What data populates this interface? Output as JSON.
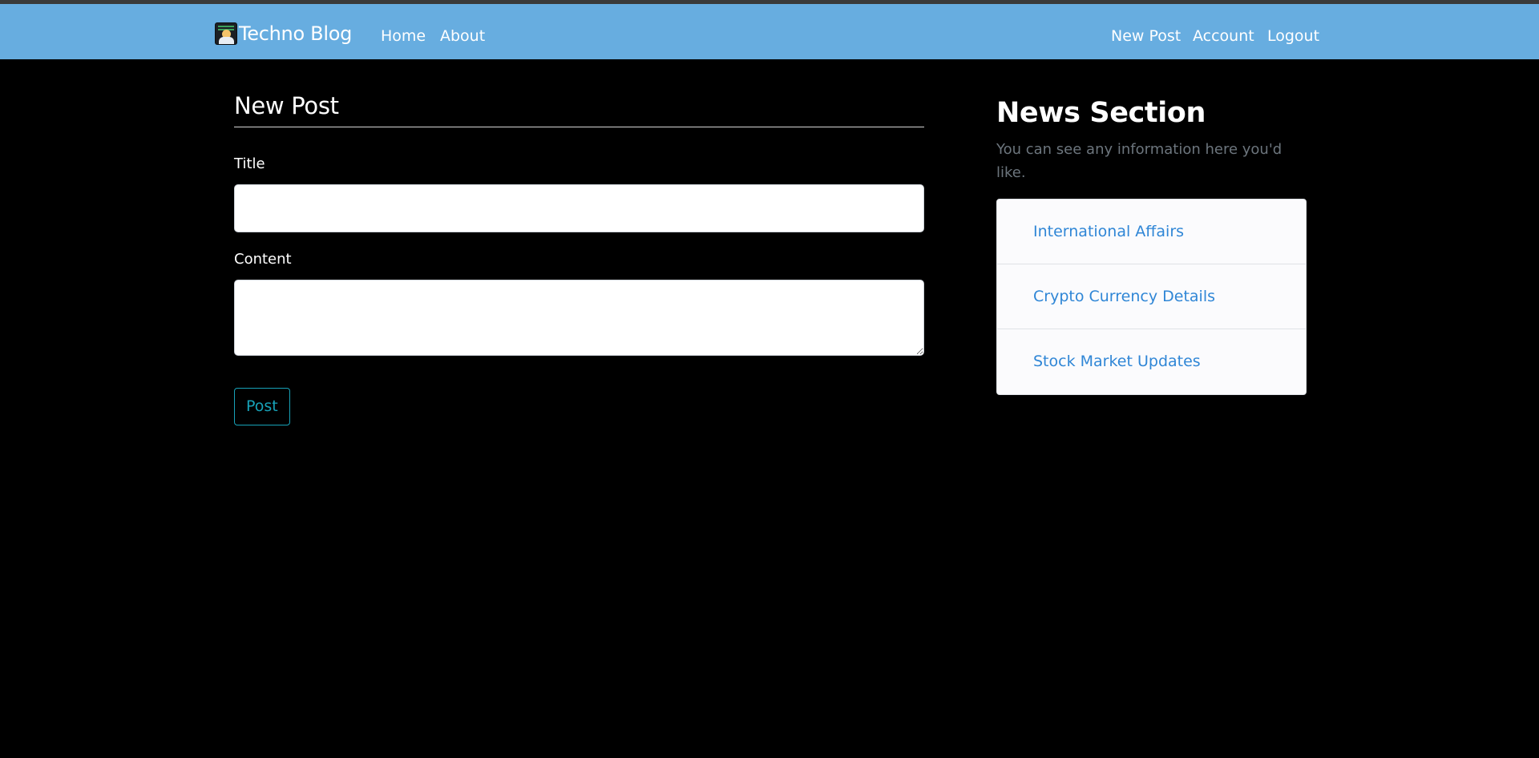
{
  "navbar": {
    "brand": "Techno Blog",
    "brand_logo": "developer-avatar-icon",
    "left_links": [
      "Home",
      "About"
    ],
    "right_links": [
      "New Post",
      "Account",
      "Logout"
    ],
    "background_color": "#67ade0"
  },
  "form": {
    "legend": "New Post",
    "title_label": "Title",
    "title_value": "",
    "content_label": "Content",
    "content_value": "",
    "submit_label": "Post"
  },
  "sidebar": {
    "title": "News Section",
    "description": "You can see any information here you'd like.",
    "items": [
      {
        "label": "International Affairs"
      },
      {
        "label": "Crypto Currency Details"
      },
      {
        "label": "Stock Market Updates"
      }
    ],
    "link_color": "#2f86d6"
  },
  "colors": {
    "page_background": "#000000",
    "accent_outline": "#17a2b8",
    "muted_text": "#6c757d"
  }
}
